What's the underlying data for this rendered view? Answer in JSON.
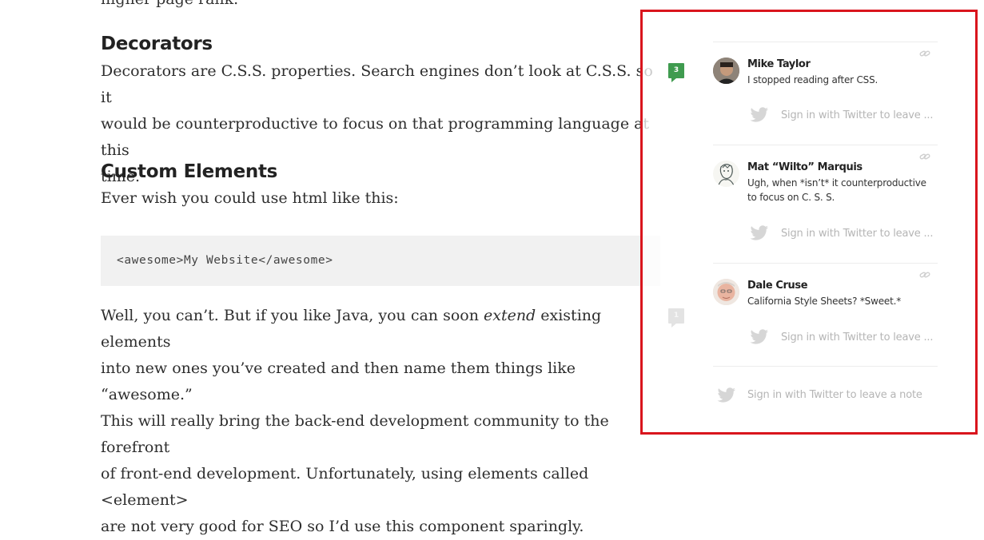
{
  "article": {
    "cutoff_text": "higher page rank.",
    "decorators_heading": "Decorators",
    "decorators_line1": "Decorators are C.S.S. properties. Search engines don’t look at C.S.S. so it",
    "decorators_line2": "would be counterproductive to focus on that programming language at this",
    "decorators_line3": "time.",
    "custom_heading": "Custom Elements",
    "custom_intro": "Ever wish you could use html like this:",
    "code_sample": "<awesome>My Website</awesome>",
    "para_line1_pre": "Well, you can’t. But if you like Java, you can soon ",
    "para_line1_em": "extend",
    "para_line1_post": " existing elements",
    "para_line2": "into new ones you’ve created and then name them things like “awesome.”",
    "para_line3": "This will really bring the back-end development community to the forefront",
    "para_line4": "of front-end development. Unfortunately, using elements called <element>",
    "para_line5": "are not very good for SEO so I’d use this component sparingly."
  },
  "notes": {
    "badge_counts": [
      "3",
      "1"
    ],
    "comments": [
      {
        "author": "Mike Taylor",
        "text": "I stopped reading after CSS.",
        "reply": "Sign in with Twitter to leave ..."
      },
      {
        "author": "Mat “Wilto” Marquis",
        "text": "Ugh, when *isn’t* it counterproductive to focus on C. S. S.",
        "reply": "Sign in with Twitter to leave ..."
      },
      {
        "author": "Dale Cruse",
        "text": "California Style Sheets? *Sweet.*",
        "reply": "Sign in with Twitter to leave ..."
      }
    ],
    "footer_signin": "Sign in with Twitter to leave a note"
  },
  "colors": {
    "highlight_frame": "#d9151d",
    "badge_active": "#3f9b4f",
    "badge_inactive": "#e3e3e3"
  },
  "icons": [
    "link-icon",
    "twitter-icon",
    "note-count-badge"
  ]
}
